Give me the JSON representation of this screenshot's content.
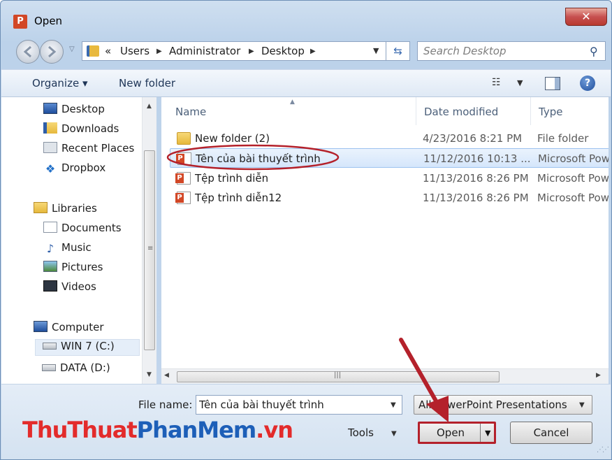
{
  "window": {
    "title": "Open",
    "app_icon_letter": "P",
    "close_glyph": "✕"
  },
  "navigation": {
    "back_icon": "back-arrow-icon",
    "forward_icon": "forward-arrow-icon",
    "address": {
      "overflow": "«",
      "segments": [
        "Users",
        "Administrator",
        "Desktop"
      ]
    },
    "search": {
      "placeholder": "Search Desktop"
    }
  },
  "toolbar": {
    "organize_label": "Organize ▾",
    "new_folder_label": "New folder",
    "help_glyph": "?"
  },
  "sidebar": {
    "items": [
      {
        "label": "Desktop",
        "icon": "desktop-icon"
      },
      {
        "label": "Downloads",
        "icon": "downloads-icon"
      },
      {
        "label": "Recent Places",
        "icon": "recent-places-icon"
      },
      {
        "label": "Dropbox",
        "icon": "dropbox-icon"
      },
      {
        "label": "Libraries",
        "icon": "libraries-icon"
      },
      {
        "label": "Documents",
        "icon": "documents-icon"
      },
      {
        "label": "Music",
        "icon": "music-icon"
      },
      {
        "label": "Pictures",
        "icon": "pictures-icon"
      },
      {
        "label": "Videos",
        "icon": "videos-icon"
      },
      {
        "label": "Computer",
        "icon": "computer-icon"
      },
      {
        "label": "WIN 7 (C:)",
        "icon": "drive-icon"
      },
      {
        "label": "DATA (D:)",
        "icon": "drive-icon"
      }
    ],
    "selected": "WIN 7 (C:)"
  },
  "files": {
    "columns": [
      "Name",
      "Date modified",
      "Type"
    ],
    "rows": [
      {
        "name": "New folder (2)",
        "date": "4/23/2016 8:21 PM",
        "type": "File folder",
        "icon": "folder-icon"
      },
      {
        "name": "Tên của bài thuyết trình",
        "date": "11/12/2016 10:13 ...",
        "type": "Microsoft PowerPoint",
        "icon": "powerpoint-file-icon"
      },
      {
        "name": "Tệp trình diễn",
        "date": "11/13/2016 8:26 PM",
        "type": "Microsoft PowerPoint",
        "icon": "powerpoint-file-icon"
      },
      {
        "name": "Tệp trình diễn12",
        "date": "11/13/2016 8:26 PM",
        "type": "Microsoft PowerPoint",
        "icon": "powerpoint-file-icon"
      }
    ],
    "selected": "Tên của bài thuyết trình"
  },
  "footer": {
    "filename_label": "File name:",
    "filename_value": "Tên của bài thuyết trình",
    "filetype_value": "All PowerPoint Presentations",
    "tools_label": "Tools",
    "open_label": "Open",
    "cancel_label": "Cancel"
  },
  "watermark": {
    "part1": "ThuThuat",
    "part2": "PhanMem",
    "part3": ".vn"
  },
  "colors": {
    "annotation_red": "#b4212b",
    "selection_blue": "#d5e6fb",
    "watermark_red": "#e32b2b",
    "watermark_blue": "#1d5fb8"
  }
}
